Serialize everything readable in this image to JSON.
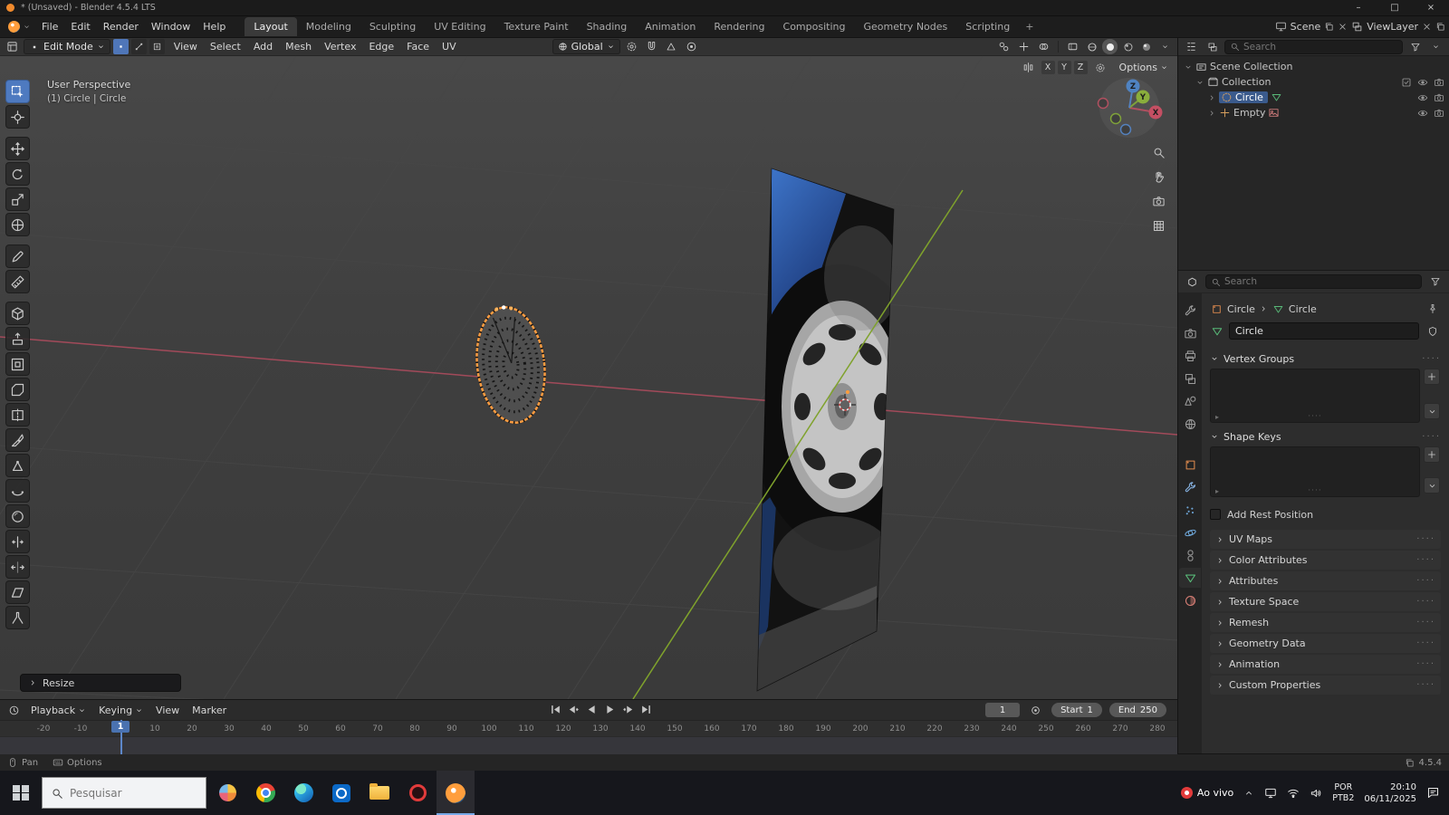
{
  "window": {
    "title": "* (Unsaved) - Blender 4.5.4 LTS"
  },
  "topbar": {
    "app_menus": [
      "File",
      "Edit",
      "Render",
      "Window",
      "Help"
    ],
    "workspaces": [
      "Layout",
      "Modeling",
      "Sculpting",
      "UV Editing",
      "Texture Paint",
      "Shading",
      "Animation",
      "Rendering",
      "Compositing",
      "Geometry Nodes",
      "Scripting"
    ],
    "active_workspace": "Layout",
    "add_tab": "+",
    "scene": "Scene",
    "view_layer": "ViewLayer"
  },
  "viewport_header": {
    "mode": "Edit Mode",
    "menus": [
      "View",
      "Select",
      "Add",
      "Mesh",
      "Vertex",
      "Edge",
      "Face",
      "UV"
    ],
    "orientation": "Global"
  },
  "viewport": {
    "perspective_label": "User Perspective",
    "context_label": "(1) Circle | Circle",
    "operator_label": "Resize",
    "options_label": "Options",
    "mirror_axes": [
      "X",
      "Y",
      "Z"
    ],
    "gizmo_axes": {
      "x": "X",
      "y": "Y",
      "z": "Z"
    }
  },
  "toolbar": {
    "active_tool": "select-box",
    "tools": [
      "select-box",
      "cursor",
      "move",
      "rotate",
      "scale",
      "transform",
      "annotate",
      "measure",
      "add-primitive",
      "extrude-region",
      "inset-faces",
      "bevel",
      "loop-cut",
      "knife",
      "poly-build",
      "spin",
      "smooth",
      "edge-slide",
      "shrink-fatten",
      "shear",
      "rip-region"
    ]
  },
  "outliner": {
    "search_placeholder": "Search",
    "rows": [
      {
        "label": "Scene Collection",
        "icon": "scene-collection",
        "level": 0,
        "expand": "open",
        "right": []
      },
      {
        "label": "Collection",
        "icon": "collection",
        "level": 1,
        "expand": "open",
        "right": [
          "checkbox",
          "eye",
          "camera"
        ]
      },
      {
        "label": "Circle",
        "icon": "mesh-circle",
        "level": 2,
        "expand": "closed",
        "selected": true,
        "extra": "mesh-data",
        "right": [
          "eye",
          "camera"
        ]
      },
      {
        "label": "Empty",
        "icon": "empty-axes",
        "level": 2,
        "expand": "closed",
        "extra": "image",
        "right": [
          "eye",
          "camera"
        ]
      }
    ]
  },
  "properties": {
    "search_placeholder": "Search",
    "tabs": [
      "tool",
      "render",
      "output",
      "view-layer",
      "scene",
      "world",
      "object",
      "modifiers",
      "particles",
      "physics",
      "constraints",
      "data",
      "material"
    ],
    "active_tab": "data",
    "breadcrumb": {
      "object": "Circle",
      "data": "Circle"
    },
    "name_field": "Circle",
    "vertex_groups_label": "Vertex Groups",
    "shape_keys_label": "Shape Keys",
    "add_rest_label": "Add Rest Position",
    "collapsed_panels": [
      "UV Maps",
      "Color Attributes",
      "Attributes",
      "Texture Space",
      "Remesh",
      "Geometry Data",
      "Animation",
      "Custom Properties"
    ]
  },
  "timeline": {
    "menus": [
      "Playback",
      "Keying",
      "View",
      "Marker"
    ],
    "current_frame": "1",
    "start_label": "Start",
    "start_value": "1",
    "end_label": "End",
    "end_value": "250",
    "ticks": [
      "-20",
      "-10",
      "0",
      "10",
      "20",
      "30",
      "40",
      "50",
      "60",
      "70",
      "80",
      "90",
      "100",
      "110",
      "120",
      "130",
      "140",
      "150",
      "160",
      "170",
      "180",
      "190",
      "200",
      "210",
      "220",
      "230",
      "240",
      "250",
      "260",
      "270",
      "280"
    ]
  },
  "statusbar": {
    "pan_label": "Pan",
    "options_label": "Options",
    "version": "4.5.4"
  },
  "taskbar": {
    "search_placeholder": "Pesquisar",
    "apps": [
      "widgets",
      "chrome",
      "edge",
      "outlook",
      "explorer",
      "media",
      "blender"
    ],
    "active_app": "blender",
    "live_label": "Ao vivo",
    "lang_top": "POR",
    "lang_bottom": "PTB2",
    "time": "20:10",
    "date": "06/11/2025"
  }
}
